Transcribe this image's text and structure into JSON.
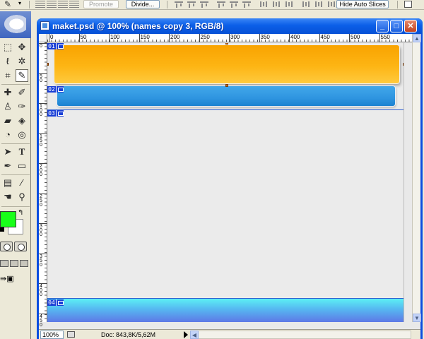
{
  "options_bar": {
    "promote_label": "Promote",
    "divide_label": "Divide...",
    "hide_auto_slices_label": "Hide Auto Slices"
  },
  "document": {
    "title": "maket.psd @ 100% (names copy 3, RGB/8)",
    "ruler_h_labels": [
      "0",
      "50",
      "100",
      "150",
      "200",
      "250",
      "300",
      "350",
      "400",
      "450",
      "500",
      "550"
    ],
    "ruler_v_labels": [
      "0",
      "50",
      "100",
      "150",
      "200",
      "250",
      "300",
      "350",
      "400",
      "450"
    ],
    "slices": [
      "01",
      "02",
      "03",
      "04"
    ],
    "zoom": "100%",
    "doc_info": "Doc: 843,8K/5,62M"
  },
  "toolbox": {
    "foreground_color": "#19FF19",
    "background_color": "#FFFFFF",
    "icons": [
      "slice-select-icon",
      "marquee-icon",
      "move-icon",
      "lasso-icon",
      "magic-wand-icon",
      "crop-icon",
      "slice-icon",
      "healing-brush-icon",
      "brush-icon",
      "clone-stamp-icon",
      "history-brush-icon",
      "eraser-icon",
      "paint-bucket-icon",
      "dodge-icon",
      "pen-icon",
      "path-select-icon",
      "type-icon",
      "custom-shape-icon",
      "rectangle-icon",
      "notes-icon",
      "eyedropper-icon",
      "hand-icon",
      "zoom-icon"
    ]
  },
  "colors": {
    "title_bar": "#0B5FE8",
    "orange_bar": "#FDB514",
    "blue_bar": "#2F95E0",
    "cyan_bar": "#56B7F1",
    "slice_label": "#1A3FD6"
  }
}
